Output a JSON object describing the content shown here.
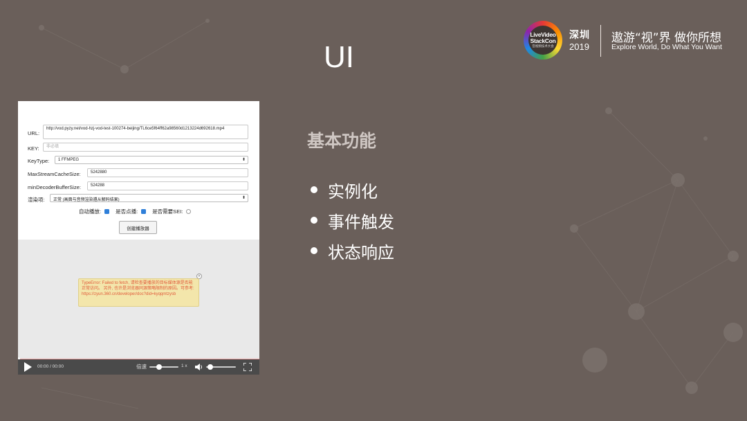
{
  "header": {
    "logo": {
      "line1": "LiveVideo",
      "line2": "StackCon",
      "line3": "音视频技术大会",
      "city": "深圳",
      "year": "2019"
    },
    "slogan_cn": "遨游“视”界  做你所想",
    "slogan_en": "Explore World, Do What You Want"
  },
  "slide": {
    "title": "UI"
  },
  "screenshot": {
    "form": {
      "url_label": "URL:",
      "url_value": "http://vod.pyzy.net/vod-hzj-vod-test-100274-beijing/TL6ce5f64ff62a98560d1213224d692618.mp4",
      "key_label": "KEY:",
      "key_placeholder": "非必填",
      "keytype_label": "KeyType:",
      "keytype_value": "1 FFMPEG",
      "maxstream_label": "MaxStreamCacheSize:",
      "maxstream_value": "5242880",
      "mindecoder_label": "minDecoderBufferSize:",
      "mindecoder_value": "524288",
      "render_label": "渲染项:",
      "render_value": "正常 (画面与音频渲染遵从解码结果)",
      "autoplay_label": "自动播放:",
      "vod_label": "是否点播:",
      "sei_label": "是否需要SEI:",
      "create_button": "创建播放器"
    },
    "error_tip": "TypeError: Failed to fetch, 请检查要播放的目标媒体源是否能正常访问。 另外, 也许是浏览器同源策略限制的原因。可参考: https://zyun.360.cn/developer/doc?did=kyqqmtzysb",
    "close_glyph": "×",
    "controls": {
      "time": "00:00 / 00:00",
      "speed_label": "倍速",
      "speed_value": "1 x"
    }
  },
  "content": {
    "section_title": "基本功能",
    "bullets": [
      "实例化",
      "事件触发",
      "状态响应"
    ]
  },
  "colors": {
    "background": "#6a5f5a",
    "checkbox_on": "#2f7fd9",
    "error_bg": "#f3e6ab",
    "error_text": "#e05a3a",
    "control_bar": "#4a4a4a",
    "section_title": "#cfc7c3"
  }
}
